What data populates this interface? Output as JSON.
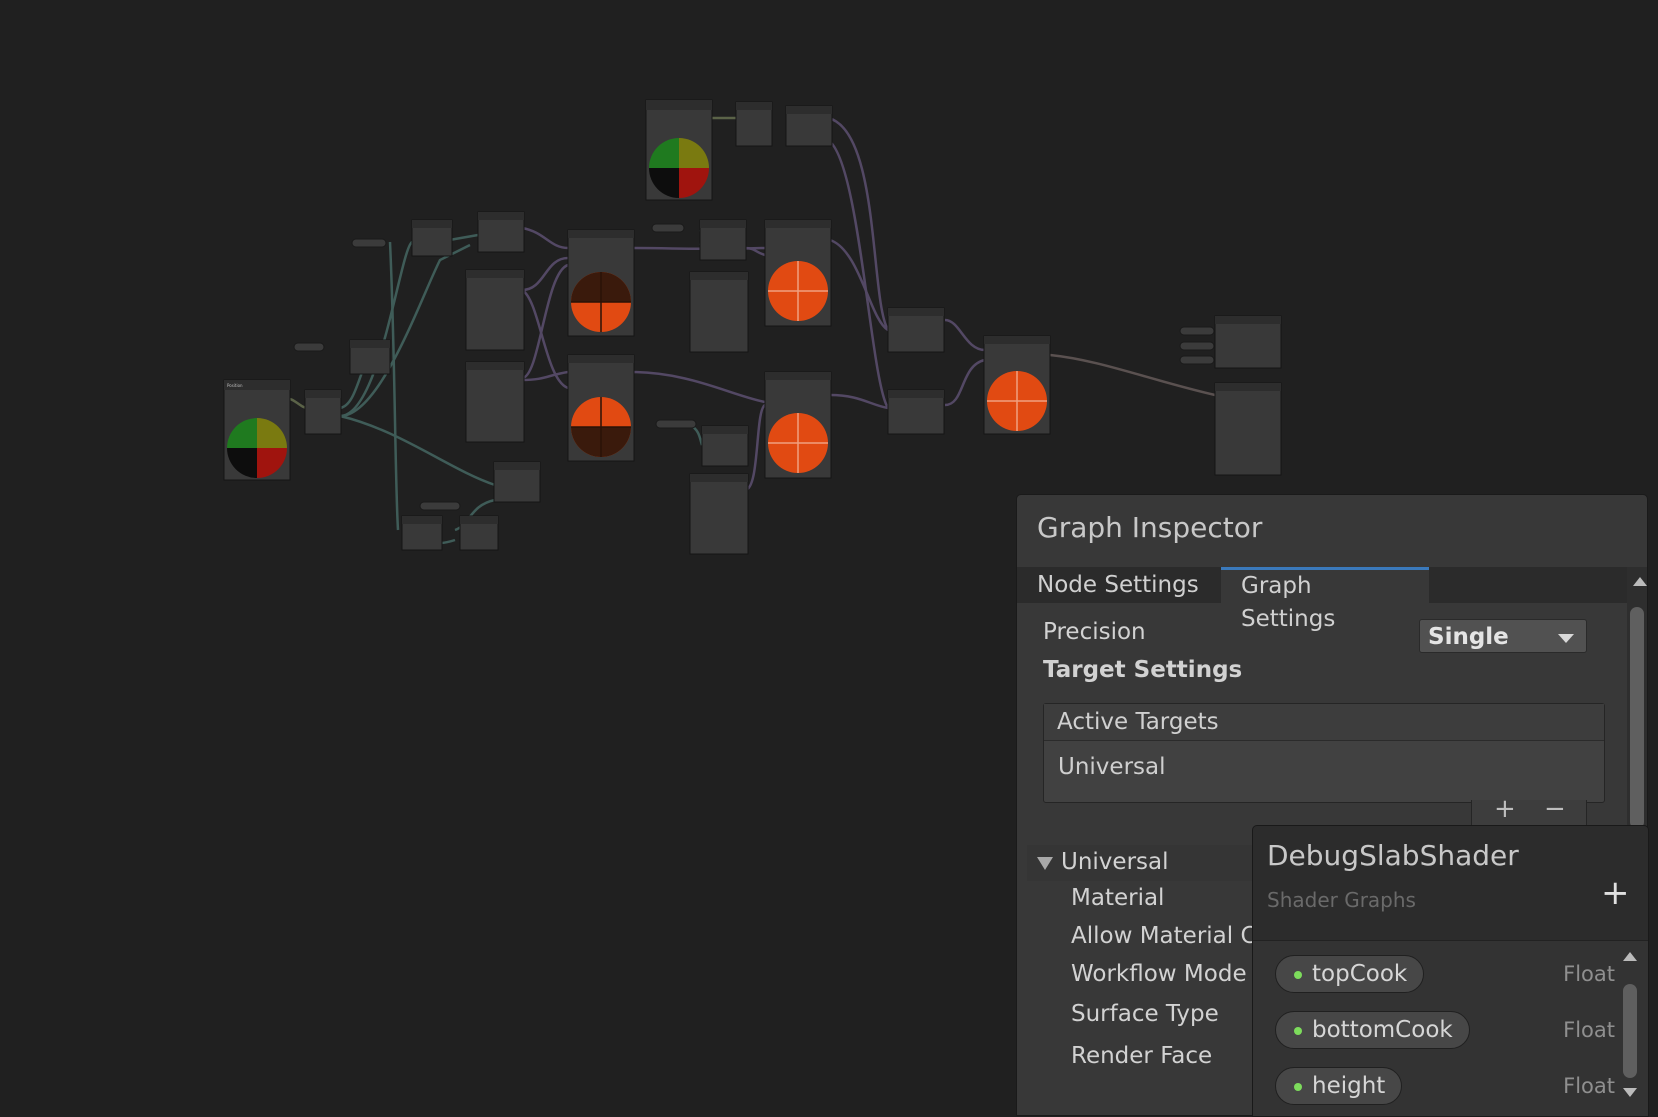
{
  "inspector": {
    "title": "Graph Inspector",
    "tabs": [
      {
        "label": "Node Settings",
        "active": false
      },
      {
        "label": "Graph Settings",
        "active": true
      }
    ],
    "precision_label": "Precision",
    "precision_value": "Single",
    "target_settings_label": "Target Settings",
    "active_targets": {
      "header": "Active Targets",
      "items": [
        "Universal"
      ],
      "add": "+",
      "remove": "−"
    },
    "universal_section": {
      "title": "Universal",
      "fields": [
        "Material",
        "Allow Material C",
        "Workflow Mode",
        "Surface Type",
        "Render Face"
      ]
    }
  },
  "blackboard": {
    "title": "DebugSlabShader",
    "subtitle": "Shader Graphs",
    "add": "+",
    "properties": [
      {
        "name": "topCook",
        "type": "Float"
      },
      {
        "name": "bottomCook",
        "type": "Float"
      },
      {
        "name": "height",
        "type": "Float"
      }
    ]
  },
  "colors": {
    "canvas_bg": "#202020",
    "accent_tab": "#3a79bb",
    "preview_orange": "#e14a12",
    "property_dot": "#7ddc5c"
  }
}
